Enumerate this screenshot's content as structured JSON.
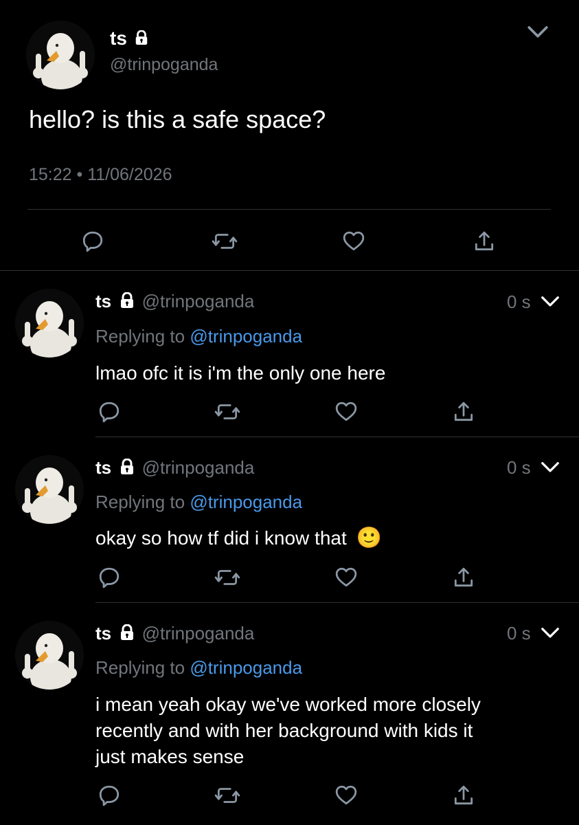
{
  "main_tweet": {
    "name": "ts",
    "handle": "@trinpoganda",
    "text": "hello? is this a safe space?",
    "timestamp": "15:22 • 11/06/2026"
  },
  "replies": [
    {
      "name": "ts",
      "handle": "@trinpoganda",
      "time": "0 s",
      "replying_prefix": "Replying to",
      "replying_handle": "@trinpoganda",
      "text": "lmao ofc it is i'm the only one here"
    },
    {
      "name": "ts",
      "handle": "@trinpoganda",
      "time": "0 s",
      "replying_prefix": "Replying to",
      "replying_handle": "@trinpoganda",
      "text": "okay so how tf did i know that",
      "emoji": "🙂"
    },
    {
      "name": "ts",
      "handle": "@trinpoganda",
      "time": "0 s",
      "replying_prefix": "Replying to",
      "replying_handle": "@trinpoganda",
      "text_lines": [
        "i mean yeah okay we've worked more closely",
        "recently and with her background with kids it",
        "just makes sense"
      ]
    }
  ],
  "icons": [
    "lock-icon",
    "chevron-down-icon",
    "reply-icon",
    "retweet-icon",
    "like-icon",
    "share-icon"
  ],
  "colors": {
    "background": "#000000",
    "muted": "#71767b",
    "link": "#4a99e9",
    "divider": "#2f3336"
  }
}
